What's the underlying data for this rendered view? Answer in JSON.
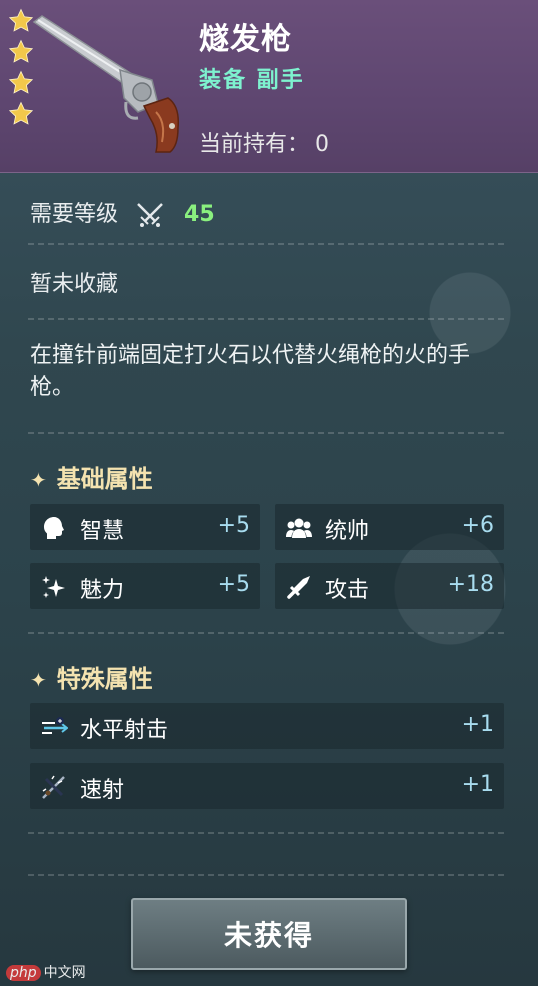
{
  "item": {
    "name": "燧发枪",
    "type": "装备 副手",
    "owned_label": "当前持有：",
    "owned_count": "0",
    "stars": 4
  },
  "requirements": {
    "level_label": "需要等级",
    "level_value": "45"
  },
  "collection_status": "暂未收藏",
  "description": "在撞针前端固定打火石以代替火绳枪的火的手枪。",
  "basic_attributes": {
    "title": "基础属性",
    "items": [
      {
        "name": "智慧",
        "value": "+5",
        "icon": "head-icon"
      },
      {
        "name": "统帅",
        "value": "+6",
        "icon": "group-icon"
      },
      {
        "name": "魅力",
        "value": "+5",
        "icon": "sparkle-icon"
      },
      {
        "name": "攻击",
        "value": "+18",
        "icon": "sword-icon"
      }
    ]
  },
  "special_attributes": {
    "title": "特殊属性",
    "items": [
      {
        "name": "水平射击",
        "value": "+1",
        "icon": "horizontal-shot-icon"
      },
      {
        "name": "速射",
        "value": "+1",
        "icon": "rapid-fire-icon"
      }
    ]
  },
  "action_button": "未获得",
  "watermark": {
    "php": "php",
    "site": "中文网"
  },
  "colors": {
    "header_bg": "#5e4670",
    "item_type": "#7ef2cf",
    "level_value": "#8af07f",
    "section_title": "#f4e3b0",
    "attr_value": "#a8dcef",
    "star": "#f2c84b"
  }
}
